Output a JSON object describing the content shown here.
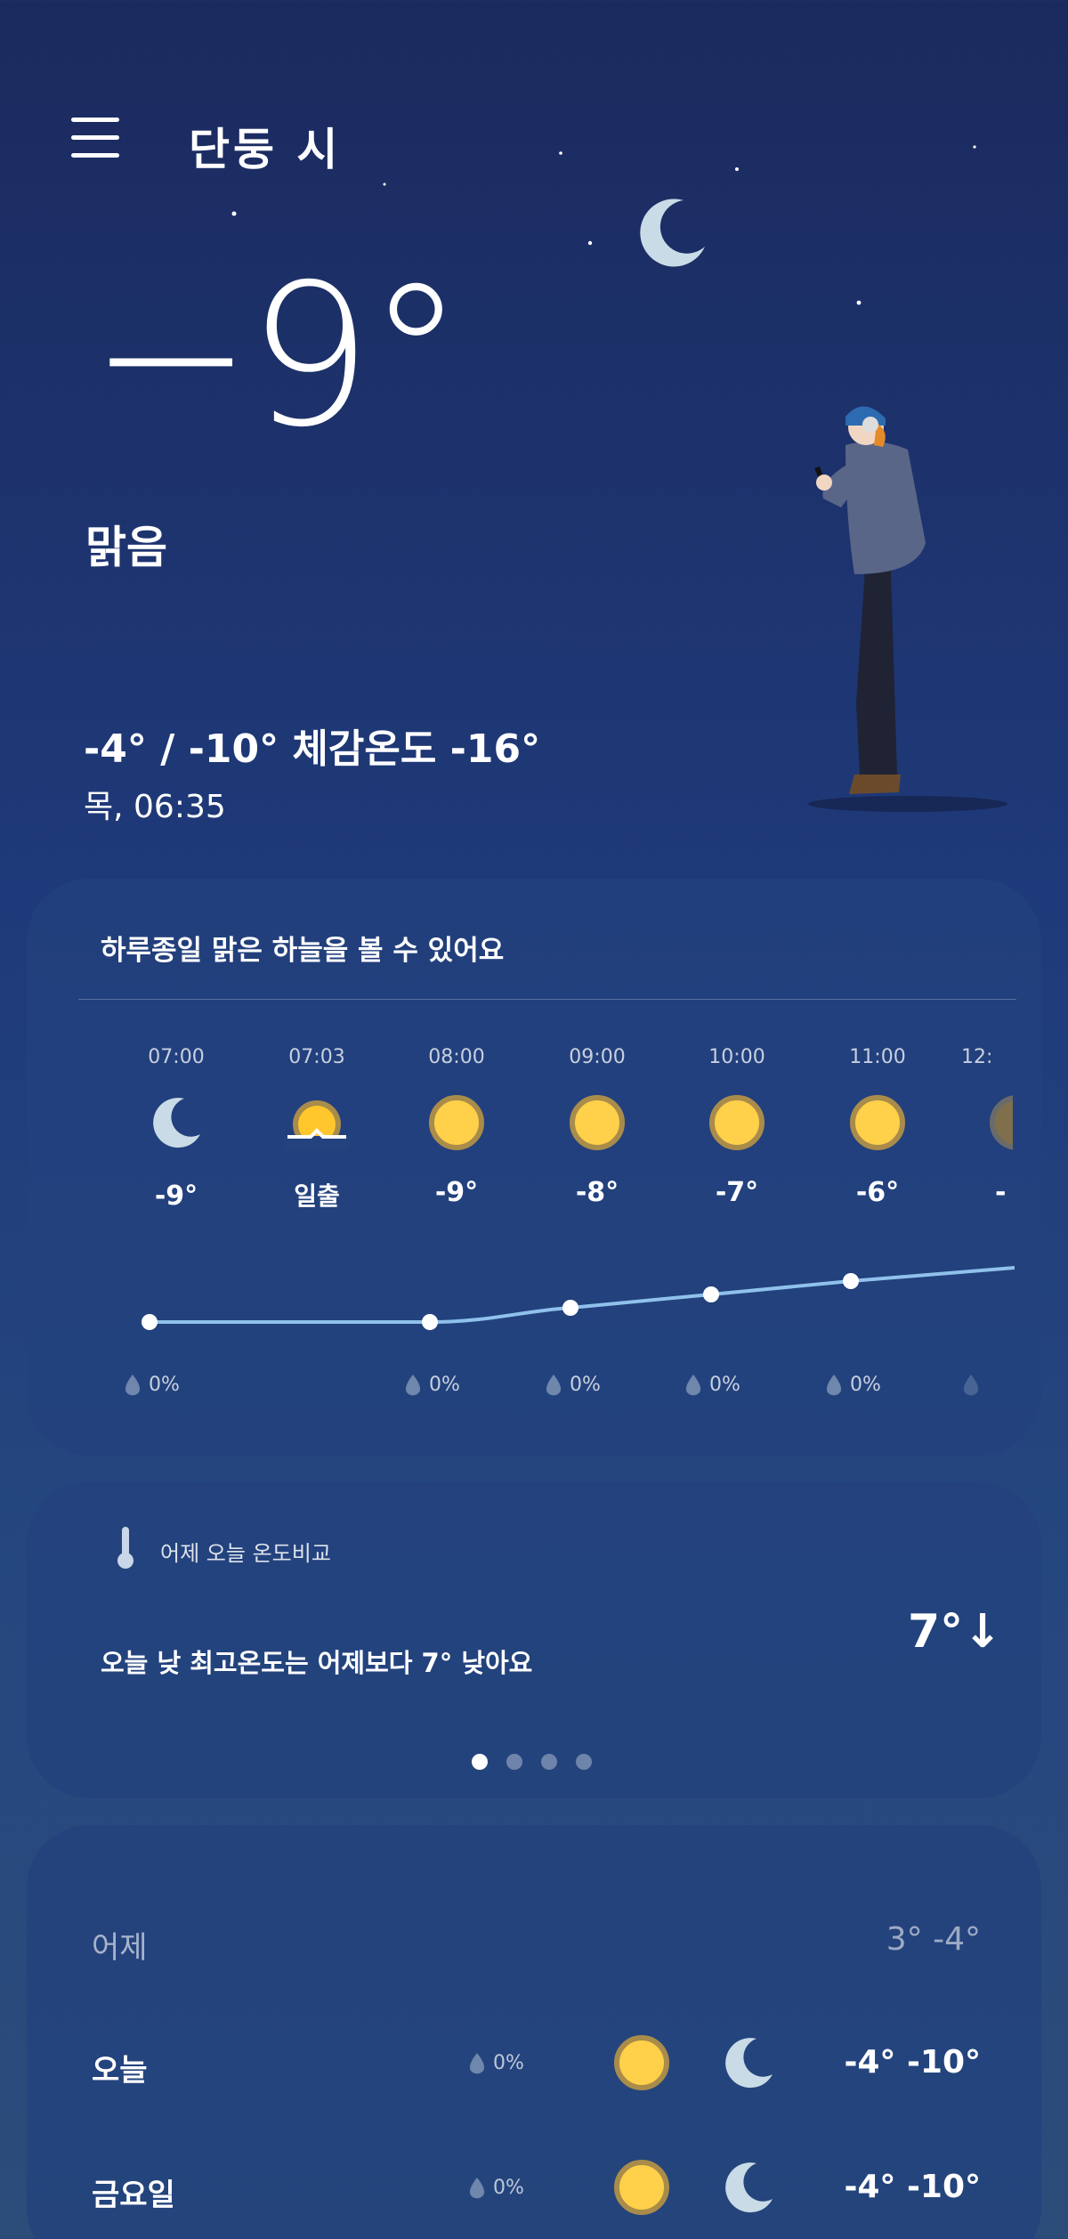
{
  "header": {
    "city": "단둥 시",
    "menu_icon": "hamburger-menu-icon"
  },
  "current": {
    "temp": "−9°",
    "condition": "맑음",
    "high_low_feels": "-4° / -10° 체감온도 -16°",
    "datetime": "목, 06:35"
  },
  "hourly": {
    "summary": "하루종일 맑은 하늘을 볼 수 있어요",
    "items": [
      {
        "time": "07:00",
        "icon": "moon-icon",
        "temp": "-9°",
        "rain": "0%"
      },
      {
        "time": "07:03",
        "icon": "sunrise-icon",
        "temp": "일출",
        "rain": ""
      },
      {
        "time": "08:00",
        "icon": "sun-icon",
        "temp": "-9°",
        "rain": "0%"
      },
      {
        "time": "09:00",
        "icon": "sun-icon",
        "temp": "-8°",
        "rain": "0%"
      },
      {
        "time": "10:00",
        "icon": "sun-icon",
        "temp": "-7°",
        "rain": "0%"
      },
      {
        "time": "11:00",
        "icon": "sun-icon",
        "temp": "-6°",
        "rain": "0%"
      },
      {
        "time": "12:",
        "icon": "sun-icon",
        "temp": "-",
        "rain": ""
      }
    ]
  },
  "compare": {
    "title": "어제 오늘 온도비교",
    "text": "오늘 낮 최고온도는 어제보다 7° 낮아요",
    "diff": "7°↓",
    "pages": 4,
    "active_page": 1
  },
  "daily": [
    {
      "day": "어제",
      "rain": "",
      "hilo": "3°  -4°"
    },
    {
      "day": "오늘",
      "rain": "0%",
      "hilo": "-4°  -10°"
    },
    {
      "day": "금요일",
      "rain": "0%",
      "hilo": "-4°  -10°"
    }
  ],
  "colors": {
    "accent_sun": "#ffd04a",
    "moon": "#c9dbe6",
    "line": "#8fc1ec"
  }
}
